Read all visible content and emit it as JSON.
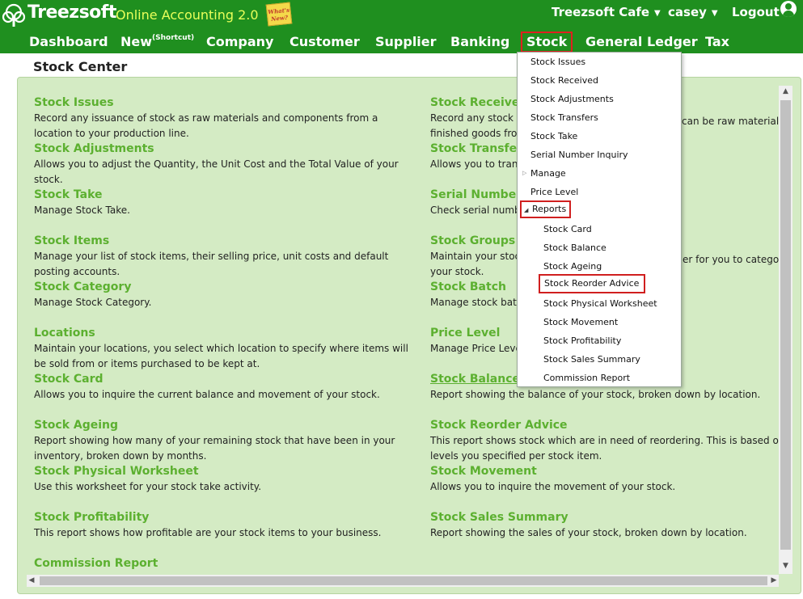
{
  "header": {
    "logo_text": "Treezsoft",
    "app_subtitle": "Online Accounting 2.0",
    "whats_new": "What's New?",
    "company": "Treezsoft Cafe",
    "user": "casey",
    "logout": "Logout"
  },
  "nav": [
    {
      "label": "Dashboard"
    },
    {
      "label": "New",
      "sup": "(Shortcut)"
    },
    {
      "label": "Company"
    },
    {
      "label": "Customer"
    },
    {
      "label": "Supplier"
    },
    {
      "label": "Banking"
    },
    {
      "label": "Stock"
    },
    {
      "label": "General Ledger"
    },
    {
      "label": "Tax"
    }
  ],
  "page_title": "Stock Center",
  "left_column": [
    {
      "title": "Stock Issues",
      "desc": [
        "Record any issuance of stock as raw materials and components from a",
        "location to your production line."
      ]
    },
    {
      "title": "Stock Adjustments",
      "desc": [
        "Allows you to adjust the Quantity, the Unit Cost and the Total Value of your",
        "stock."
      ]
    },
    {
      "title": "Stock Take",
      "desc": [
        "Manage Stock Take."
      ]
    },
    {
      "title": "Stock Items",
      "desc": [
        "Manage your list of stock items, their selling price, unit costs and default",
        "posting accounts."
      ]
    },
    {
      "title": "Stock Category",
      "desc": [
        "Manage Stock Category."
      ]
    },
    {
      "title": "Locations",
      "desc": [
        "Maintain your locations, you select which location to specify where items will",
        "be sold from or items purchased to be kept at."
      ]
    },
    {
      "title": "Stock Card",
      "desc": [
        "Allows you to inquire the current balance and movement of your stock."
      ]
    },
    {
      "title": "Stock Ageing",
      "desc": [
        "Report showing how many of your remaining stock that have been in your",
        "inventory, broken down by months."
      ]
    },
    {
      "title": "Stock Physical Worksheet",
      "desc": [
        "Use this worksheet for your stock take activity."
      ]
    },
    {
      "title": "Stock Profitability",
      "desc": [
        "This report shows how profitable are your stock items to your business."
      ]
    },
    {
      "title": "Commission Report",
      "desc": []
    }
  ],
  "right_column": [
    {
      "title": "Stock Received",
      "desc": [
        "Record any stock r",
        "finished goods fror"
      ],
      "desc_tail": "can be raw materials"
    },
    {
      "title": "Stock Transfers",
      "desc": [
        "Allows you to trans"
      ]
    },
    {
      "title": "Serial Number",
      "desc": [
        "Check serial numb"
      ]
    },
    {
      "title": "Stock Groups",
      "desc": [
        "Maintain your stoc",
        "your stock."
      ],
      "desc_tail": "er for you to categori"
    },
    {
      "title": "Stock Batch",
      "desc": [
        "Manage stock batc"
      ]
    },
    {
      "title": "Price Level",
      "desc": [
        "Manage Price Leve"
      ]
    },
    {
      "title": "Stock Balance",
      "desc": [
        "Report showing the balance of your stock, broken down by location."
      ]
    },
    {
      "title": "Stock Reorder Advice",
      "desc": [
        "This report shows stock which are in need of reordering. This is based on t",
        "levels you specified per stock item."
      ]
    },
    {
      "title": "Stock Movement",
      "desc": [
        "Allows you to inquire the movement of your stock."
      ]
    },
    {
      "title": "Stock Sales Summary",
      "desc": [
        "Report showing the sales of your stock, broken down by location."
      ]
    }
  ],
  "stock_menu": {
    "items": [
      "Stock Issues",
      "Stock Received",
      "Stock Adjustments",
      "Stock Transfers",
      "Stock Take",
      "Serial Number Inquiry",
      "Manage",
      "Price Level",
      "Reports"
    ],
    "reports": [
      "Stock Card",
      "Stock Balance",
      "Stock Ageing",
      "Stock Reorder Advice",
      "Stock Physical Worksheet",
      "Stock Movement",
      "Stock Profitability",
      "Stock Sales Summary",
      "Commission Report"
    ]
  }
}
